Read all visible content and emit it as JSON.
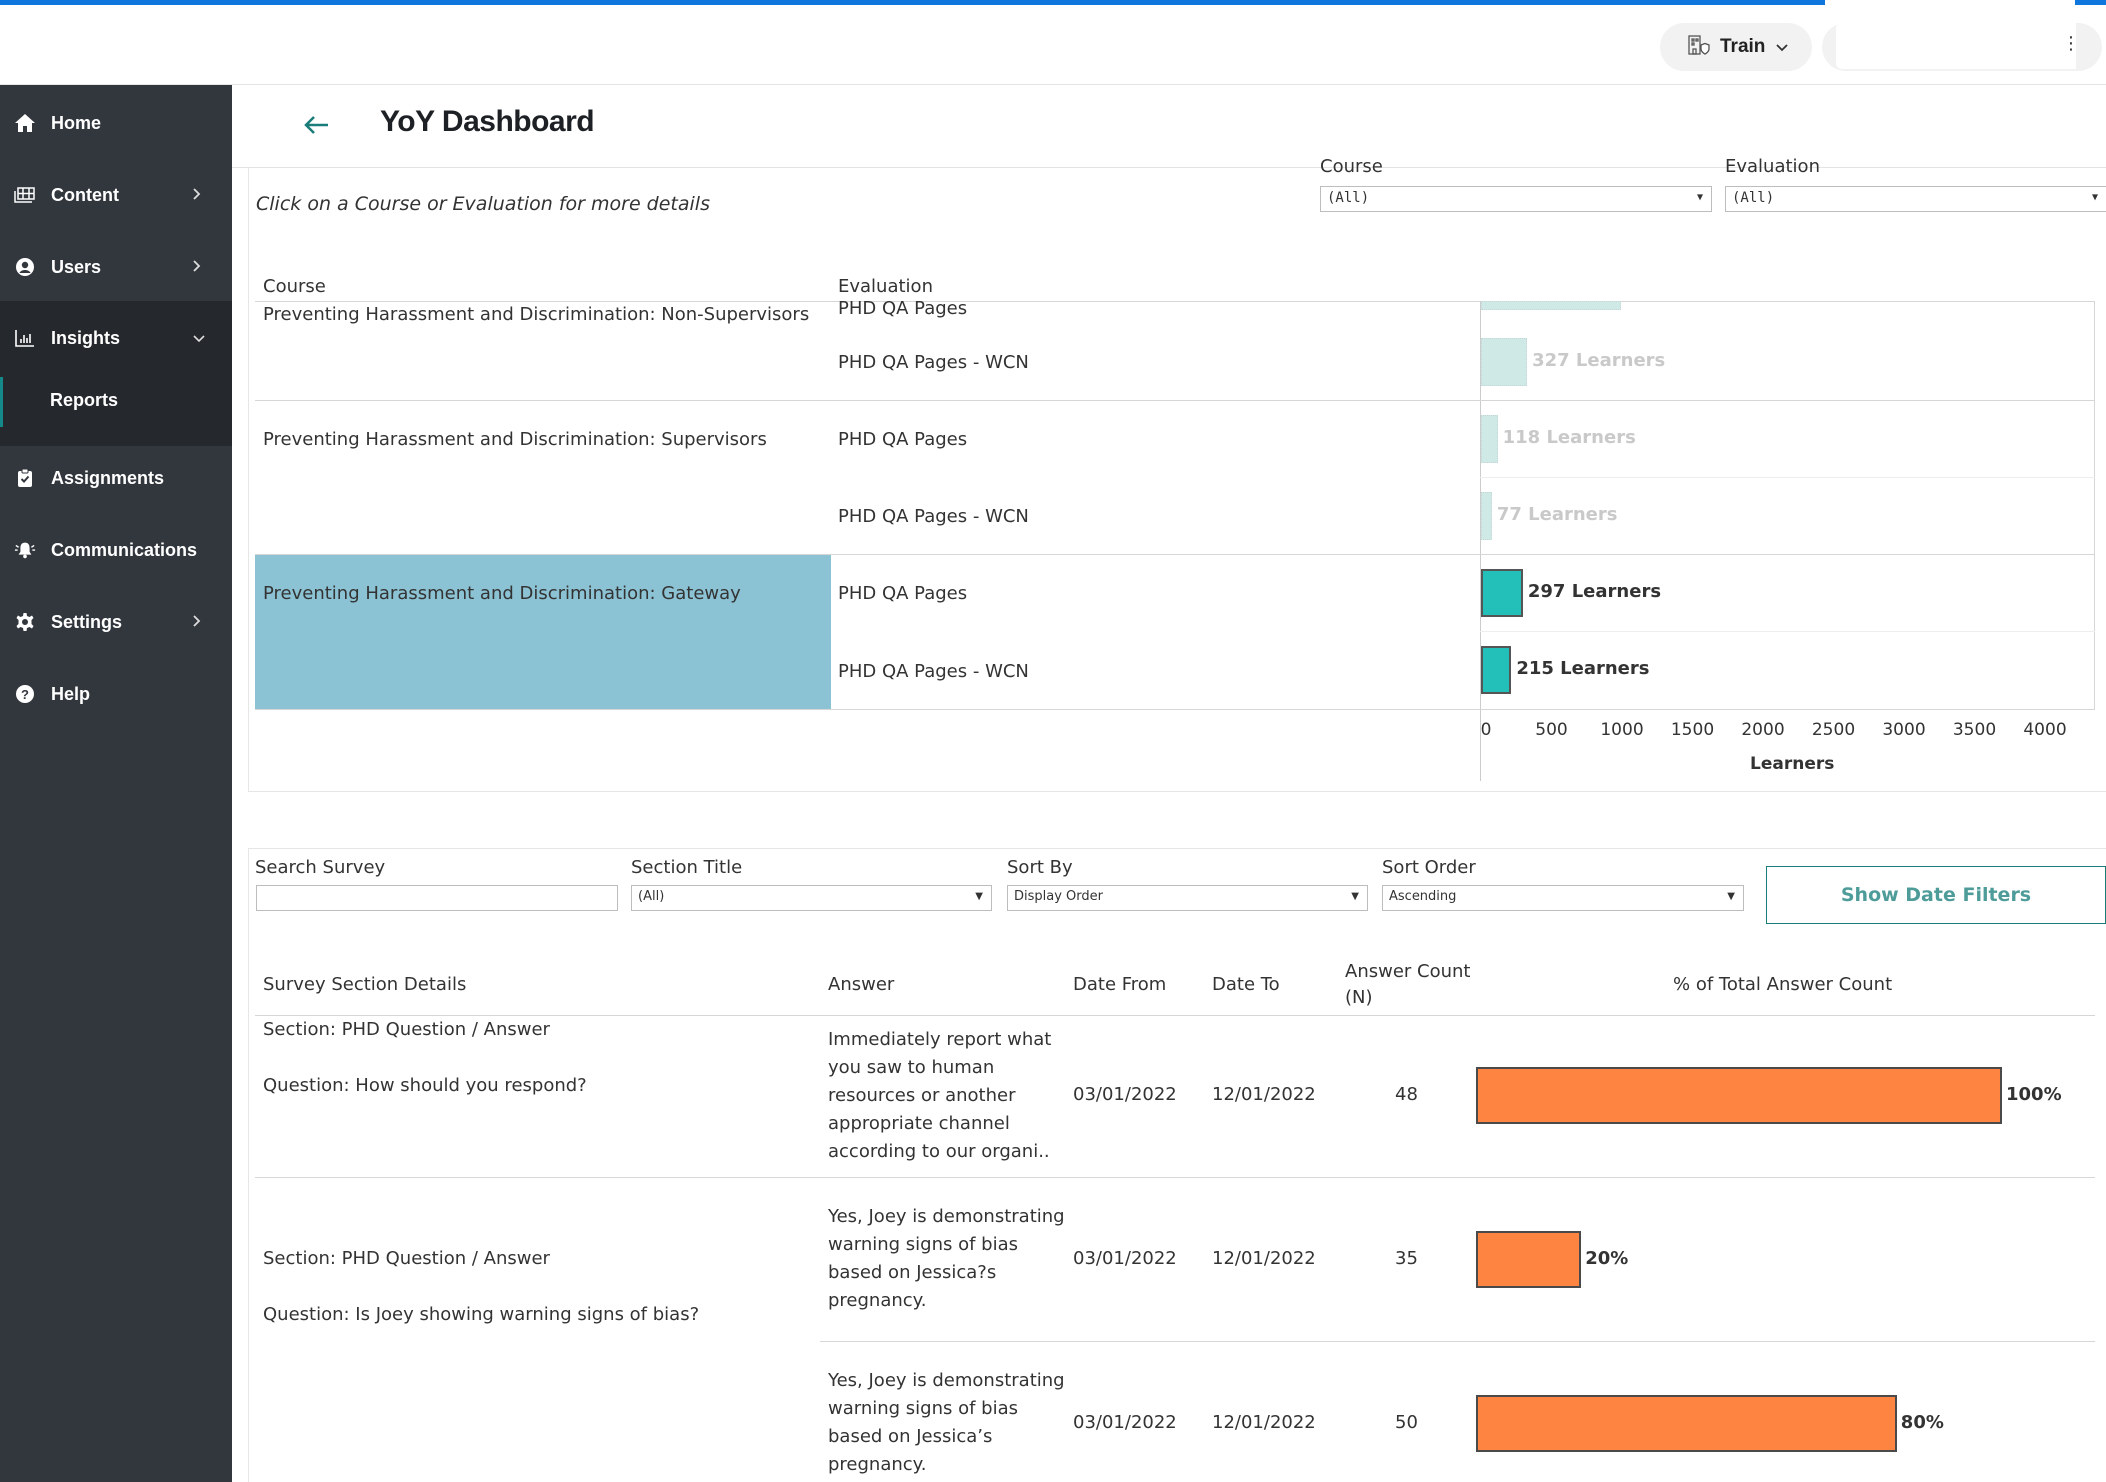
{
  "topbar": {
    "tenant_label": "Train",
    "tenant_icon": "building-shield-icon",
    "menu_icon": "vertical-dots-icon"
  },
  "sidebar": {
    "items": [
      {
        "label": "Home",
        "icon": "home-icon",
        "has_chevron": false
      },
      {
        "label": "Content",
        "icon": "content-icon",
        "has_chevron": true
      },
      {
        "label": "Users",
        "icon": "user-icon",
        "has_chevron": true
      },
      {
        "label": "Insights",
        "icon": "chart-icon",
        "has_chevron": true,
        "expanded": true
      },
      {
        "label": "Assignments",
        "icon": "clipboard-check-icon",
        "has_chevron": false
      },
      {
        "label": "Communications",
        "icon": "bell-icon",
        "has_chevron": false
      },
      {
        "label": "Settings",
        "icon": "gear-icon",
        "has_chevron": true
      },
      {
        "label": "Help",
        "icon": "help-icon",
        "has_chevron": false
      }
    ],
    "sub_items": [
      {
        "label": "Reports",
        "active": true
      }
    ]
  },
  "page": {
    "title": "YoY Dashboard",
    "hint": "Click on a Course or Evaluation for more details"
  },
  "filters_top": {
    "course_label": "Course",
    "course_value": "(All)",
    "evaluation_label": "Evaluation",
    "evaluation_value": "(All)"
  },
  "learners_table": {
    "headers": {
      "course": "Course",
      "evaluation": "Evaluation"
    },
    "axis_title": "Learners",
    "ticks": [
      "0",
      "500",
      "1000",
      "1500",
      "2000",
      "2500",
      "3000",
      "3500",
      "4000"
    ],
    "rows": [
      {
        "course": "Preventing Harassment and Discrimination: Non-Supervisors",
        "evaluation": "PHD QA Pages",
        "learners": 990,
        "label": "",
        "selected": false
      },
      {
        "course": "",
        "evaluation": "PHD QA Pages - WCN",
        "learners": 327,
        "label": "327 Learners",
        "selected": false
      },
      {
        "course": "Preventing Harassment and Discrimination: Supervisors",
        "evaluation": "PHD QA Pages",
        "learners": 118,
        "label": "118 Learners",
        "selected": false
      },
      {
        "course": "",
        "evaluation": "PHD QA Pages - WCN",
        "learners": 77,
        "label": "77 Learners",
        "selected": false
      },
      {
        "course": "Preventing Harassment and Discrimination: Gateway",
        "evaluation": "PHD QA Pages",
        "learners": 297,
        "label": "297 Learners",
        "selected": true
      },
      {
        "course": "",
        "evaluation": "PHD QA Pages - WCN",
        "learners": 215,
        "label": "215 Learners",
        "selected": true
      }
    ]
  },
  "filters_bottom": {
    "search_label": "Search Survey",
    "search_value": "",
    "section_label": "Section Title",
    "section_value": "(All)",
    "sortby_label": "Sort By",
    "sortby_value": "Display Order",
    "sortorder_label": "Sort Order",
    "sortorder_value": "Ascending",
    "date_button": "Show Date Filters"
  },
  "survey_table": {
    "headers": {
      "details": "Survey Section Details",
      "answer": "Answer",
      "date_from": "Date From",
      "date_to": "Date To",
      "count_line1": "Answer Count",
      "count_line2": "(N)",
      "pct": "% of Total Answer Count"
    },
    "groups": [
      {
        "section": "Section: PHD Question / Answer",
        "question": "Question: How should you respond?",
        "answers": [
          {
            "answer": "Immediately report what you saw to human resources or another appropriate channel according to our organi..",
            "date_from": "03/01/2022",
            "date_to": "12/01/2022",
            "count": "48",
            "pct": 100,
            "pct_label": "100%"
          }
        ]
      },
      {
        "section": "Section: PHD Question / Answer",
        "question": "Question: Is Joey showing warning signs of bias?",
        "answers": [
          {
            "answer": "Yes, Joey is demonstrating warning signs of bias based on Jessica?s pregnancy.",
            "date_from": "03/01/2022",
            "date_to": "12/01/2022",
            "count": "35",
            "pct": 20,
            "pct_label": "20%"
          },
          {
            "answer": "Yes, Joey is demonstrating warning signs of bias based on Jessica’s pregnancy.",
            "date_from": "03/01/2022",
            "date_to": "12/01/2022",
            "count": "50",
            "pct": 80,
            "pct_label": "80%"
          }
        ]
      }
    ]
  },
  "colors": {
    "accent_blue": "#0f76de",
    "sidebar_bg": "#32363d",
    "teal": "#15888a",
    "bar_selected": "#22c0b8",
    "bar_faded": "#cfe9e7",
    "highlight": "#8cc3d4",
    "orange_bar": "#fd8541"
  },
  "chart_data": [
    {
      "type": "bar",
      "orientation": "horizontal",
      "title": "",
      "xlabel": "Learners",
      "ylabel": "",
      "xlim": [
        0,
        4300
      ],
      "categories": [
        "Non-Supervisors / PHD QA Pages",
        "Non-Supervisors / PHD QA Pages - WCN",
        "Supervisors / PHD QA Pages",
        "Supervisors / PHD QA Pages - WCN",
        "Gateway / PHD QA Pages",
        "Gateway / PHD QA Pages - WCN"
      ],
      "values": [
        990,
        327,
        118,
        77,
        297,
        215
      ],
      "data_labels": [
        "",
        "327 Learners",
        "118 Learners",
        "77 Learners",
        "297 Learners",
        "215 Learners"
      ],
      "ticks": [
        0,
        500,
        1000,
        1500,
        2000,
        2500,
        3000,
        3500,
        4000
      ]
    },
    {
      "type": "bar",
      "orientation": "horizontal",
      "title": "% of Total Answer Count",
      "xlim": [
        0,
        100
      ],
      "categories": [
        "Immediately report what you saw...",
        "Yes, Joey is demonstrating... (Jessica?s)",
        "Yes, Joey is demonstrating... (Jessica’s)"
      ],
      "values": [
        100,
        20,
        80
      ],
      "data_labels": [
        "100%",
        "20%",
        "80%"
      ]
    }
  ]
}
